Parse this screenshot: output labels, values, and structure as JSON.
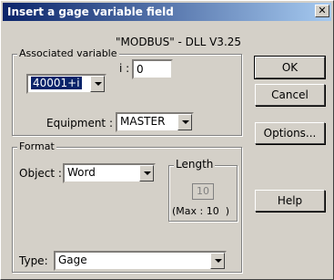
{
  "dialog": {
    "title": "Insert a gage variable field",
    "close_glyph": "✕",
    "subtitle": "\"MODBUS\" - DLL V3.25"
  },
  "associated_variable": {
    "legend": "Associated variable",
    "variable_select": "40001+i",
    "i_label": "i :",
    "i_value": "0",
    "equipment_label": "Equipment :",
    "equipment_value": "MASTER"
  },
  "format": {
    "legend": "Format",
    "object_label": "Object :",
    "object_value": "Word",
    "length_legend": "Length",
    "length_value": "10",
    "length_max": "(Max : 10  )",
    "type_label": "Type:",
    "type_value": "Gage"
  },
  "buttons": {
    "ok": "OK",
    "cancel": "Cancel",
    "options": "Options...",
    "help": "Help"
  },
  "colors": {
    "title_start": "#0a246a",
    "title_end": "#a6caf0",
    "face": "#d4d0c8",
    "selection": "#0a246a"
  }
}
